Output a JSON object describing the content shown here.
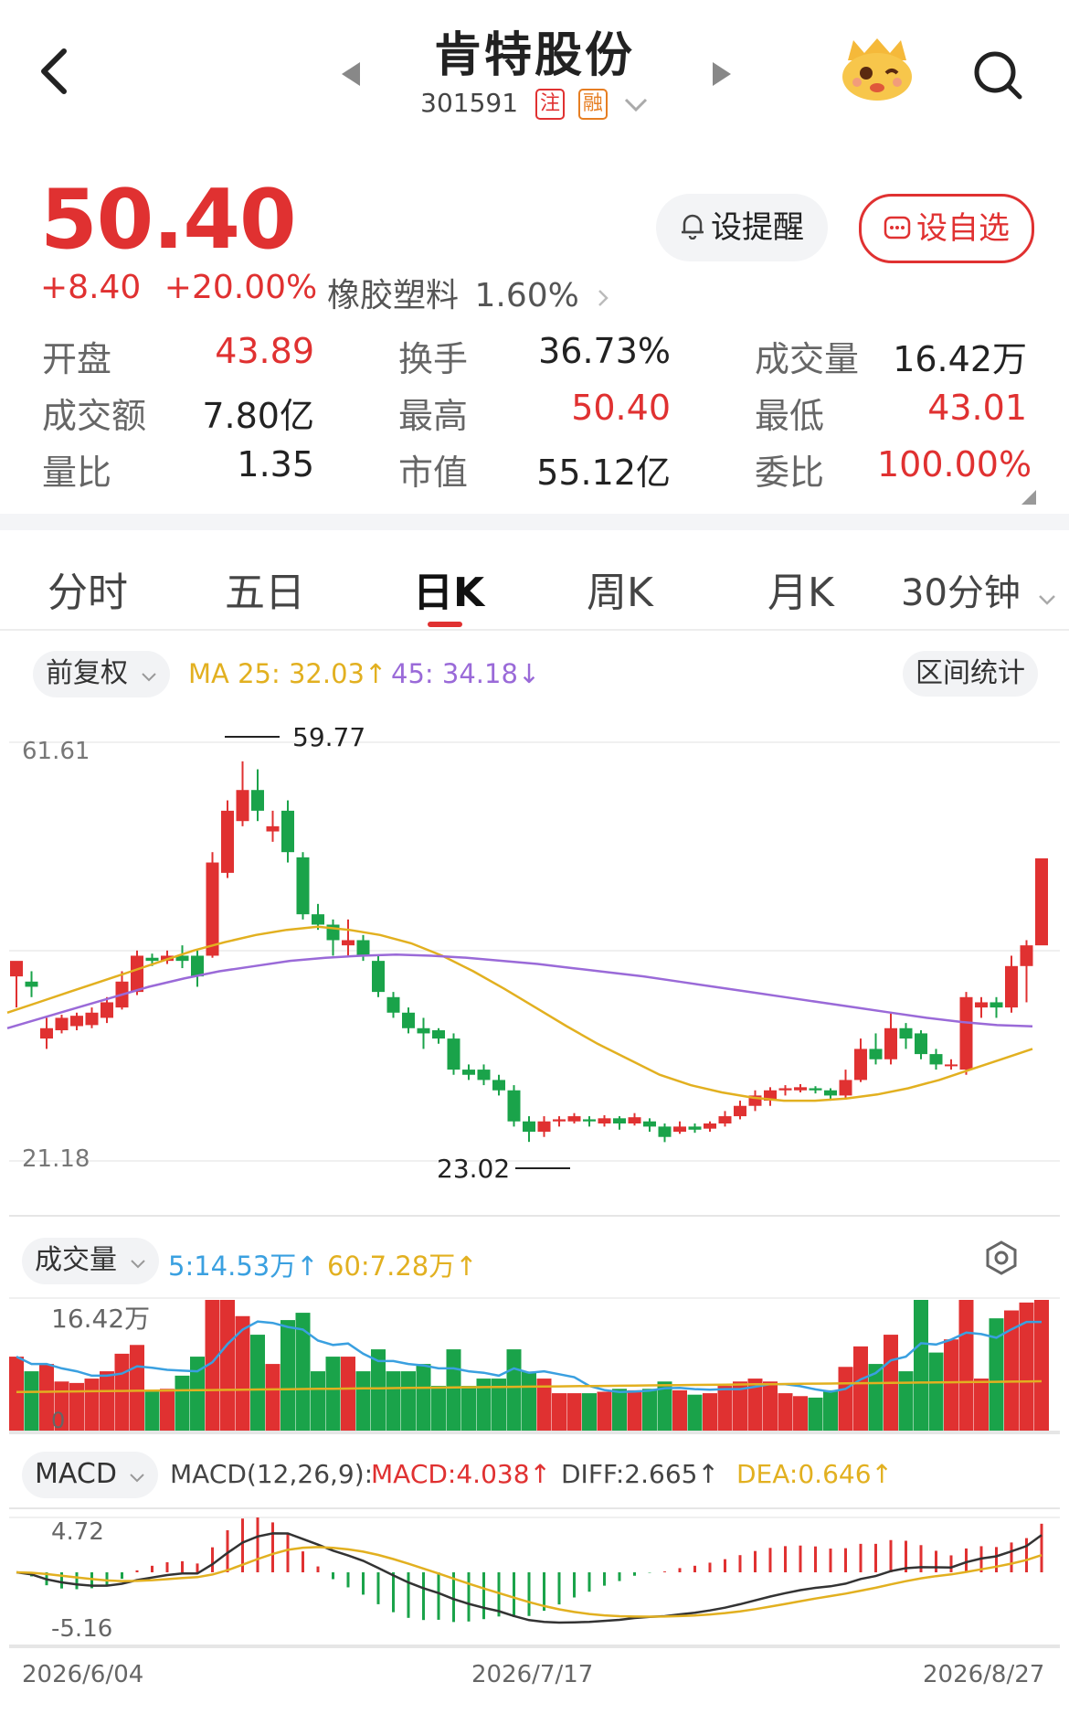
{
  "header": {
    "title": "肯特股份",
    "code": "301591",
    "tag_1": "注",
    "tag_2": "融"
  },
  "quote": {
    "price": "50.40",
    "change": "+8.40",
    "change_pct": "+20.00%",
    "sector": "橡胶塑料",
    "sector_pct": "1.60%",
    "alert_label": "设提醒",
    "fav_label": "设自选"
  },
  "stats": [
    {
      "label": "开盘",
      "value": "43.89",
      "color": "#e03131"
    },
    {
      "label": "换手",
      "value": "36.73%",
      "color": "#222222"
    },
    {
      "label": "成交量",
      "value": "16.42万",
      "color": "#222222"
    },
    {
      "label": "成交额",
      "value": "7.80亿",
      "color": "#222222"
    },
    {
      "label": "最高",
      "value": "50.40",
      "color": "#e03131"
    },
    {
      "label": "最低",
      "value": "43.01",
      "color": "#e03131"
    },
    {
      "label": "量比",
      "value": "1.35",
      "color": "#222222"
    },
    {
      "label": "市值",
      "value": "55.12亿",
      "color": "#222222"
    },
    {
      "label": "委比",
      "value": "100.00%",
      "color": "#e03131"
    }
  ],
  "tabs": {
    "t1": "分时",
    "t2": "五日",
    "t3": "日K",
    "t4": "周K",
    "t5": "月K",
    "t6": "30分钟",
    "active": "日K"
  },
  "kline": {
    "adjust": "前复权",
    "ma25": "MA 25: 32.03↑",
    "ma45": "45: 34.18↓",
    "range_stats": "区间统计",
    "ymax_label": "61.61",
    "ymin_label": "21.18",
    "high_label": "59.77",
    "low_label": "23.02"
  },
  "volume": {
    "label": "成交量",
    "ma5": "5:14.53万↑",
    "ma60": "60:7.28万↑",
    "max_label": "16.42万",
    "zero_label": "0"
  },
  "macd": {
    "label": "MACD",
    "params": "MACD(12,26,9):",
    "macd": "MACD:4.038↑",
    "diff": "DIFF:2.665↑",
    "dea": "DEA:0.646↑",
    "top_label": "4.72",
    "bottom_label": "-5.16"
  },
  "dates": {
    "d1": "2026/6/04",
    "d2": "2026/7/17",
    "d3": "2026/8/27"
  },
  "colors": {
    "up": "#e03131",
    "down": "#1aa34a",
    "ma25": "#e2b020",
    "ma45": "#9a6ad8",
    "ma5_vol": "#3aa0e0"
  },
  "chart_data": {
    "type": "candlestick",
    "ylim": [
      21.18,
      61.61
    ],
    "candles": [
      [
        39.0,
        40.5,
        36.0,
        39.5
      ],
      [
        38.5,
        38.0,
        37.0,
        39.5
      ],
      [
        33.0,
        34.0,
        32.0,
        35.0
      ],
      [
        33.8,
        35.0,
        33.5,
        35.3
      ],
      [
        34.2,
        35.2,
        33.8,
        35.5
      ],
      [
        34.3,
        35.5,
        34.0,
        36.0
      ],
      [
        35.0,
        36.5,
        34.5,
        37.0
      ],
      [
        36.0,
        38.5,
        35.8,
        39.5
      ],
      [
        37.5,
        41.0,
        37.2,
        41.5
      ],
      [
        40.8,
        40.5,
        40.0,
        41.2
      ],
      [
        40.5,
        41.0,
        40.2,
        41.5
      ],
      [
        41.0,
        40.5,
        39.8,
        42.0
      ],
      [
        41.0,
        39.0,
        38.0,
        41.5
      ],
      [
        41.0,
        50.0,
        40.8,
        51.0
      ],
      [
        49.0,
        55.0,
        48.5,
        56.0
      ],
      [
        54.0,
        57.0,
        53.5,
        59.77
      ],
      [
        57.0,
        55.0,
        54.0,
        59.0
      ],
      [
        53.0,
        53.5,
        52.0,
        55.0
      ],
      [
        55.0,
        51.0,
        50.0,
        56.0
      ],
      [
        50.5,
        45.0,
        44.5,
        51.0
      ],
      [
        45.0,
        44.0,
        43.5,
        46.0
      ],
      [
        44.0,
        42.5,
        41.0,
        44.5
      ],
      [
        42.0,
        42.5,
        41.0,
        44.5
      ],
      [
        42.5,
        41.0,
        40.5,
        43.0
      ],
      [
        40.5,
        37.5,
        37.0,
        41.0
      ],
      [
        37.0,
        35.5,
        35.0,
        37.5
      ],
      [
        35.5,
        34.0,
        33.5,
        36.0
      ],
      [
        34.0,
        33.5,
        32.0,
        35.0
      ],
      [
        33.8,
        33.0,
        32.5,
        34.0
      ],
      [
        33.0,
        30.0,
        29.5,
        33.5
      ],
      [
        30.0,
        29.5,
        29.0,
        30.5
      ],
      [
        30.0,
        29.0,
        28.5,
        30.5
      ],
      [
        29.0,
        28.0,
        27.5,
        29.5
      ],
      [
        28.0,
        25.0,
        24.5,
        28.5
      ],
      [
        25.0,
        24.0,
        23.02,
        25.5
      ],
      [
        24.0,
        25.0,
        23.5,
        25.5
      ],
      [
        25.0,
        25.2,
        24.5,
        25.5
      ],
      [
        25.0,
        25.5,
        24.8,
        25.8
      ],
      [
        25.2,
        25.0,
        24.5,
        25.5
      ],
      [
        24.8,
        25.3,
        24.5,
        25.6
      ],
      [
        25.3,
        24.8,
        24.2,
        25.5
      ],
      [
        24.8,
        25.4,
        24.6,
        25.8
      ],
      [
        25.0,
        24.5,
        24.0,
        25.3
      ],
      [
        24.5,
        23.5,
        23.0,
        24.8
      ],
      [
        24.0,
        24.5,
        23.8,
        25.0
      ],
      [
        24.5,
        24.2,
        23.9,
        24.8
      ],
      [
        24.3,
        24.8,
        24.0,
        25.0
      ],
      [
        24.8,
        25.5,
        24.5,
        26.0
      ],
      [
        25.5,
        26.5,
        25.2,
        27.0
      ],
      [
        26.5,
        27.5,
        26.0,
        28.0
      ],
      [
        27.0,
        28.0,
        26.5,
        28.3
      ],
      [
        28.0,
        28.2,
        27.5,
        28.5
      ],
      [
        28.0,
        28.3,
        27.8,
        28.6
      ],
      [
        28.2,
        28.0,
        27.7,
        28.4
      ],
      [
        28.0,
        27.5,
        27.0,
        28.2
      ],
      [
        27.5,
        29.0,
        27.2,
        30.0
      ],
      [
        29.0,
        32.0,
        28.8,
        33.0
      ],
      [
        32.0,
        31.0,
        30.5,
        33.5
      ],
      [
        31.0,
        34.0,
        30.5,
        35.5
      ],
      [
        34.0,
        33.0,
        32.0,
        34.5
      ],
      [
        33.5,
        31.5,
        31.0,
        33.8
      ],
      [
        31.5,
        30.5,
        30.0,
        32.0
      ],
      [
        30.5,
        30.5,
        30.0,
        31.0
      ],
      [
        30.0,
        37.0,
        29.5,
        37.5
      ],
      [
        36.0,
        36.5,
        35.0,
        37.0
      ],
      [
        36.5,
        36.0,
        35.0,
        37.0
      ],
      [
        36.0,
        40.0,
        35.5,
        41.0
      ],
      [
        40.0,
        42.0,
        36.5,
        42.5
      ],
      [
        42.0,
        50.4,
        43.01,
        50.4
      ]
    ],
    "ma25": [
      35.5,
      36.5,
      37.5,
      38.5,
      39.5,
      40.5,
      41.5,
      42.3,
      43.0,
      43.5,
      43.8,
      43.5,
      43.0,
      42.2,
      41.0,
      39.5,
      37.8,
      36.0,
      34.2,
      32.5,
      31.0,
      29.5,
      28.5,
      27.8,
      27.3,
      27.0,
      27.0,
      27.2,
      27.6,
      28.2,
      29.0,
      30.0,
      31.0,
      32.0
    ],
    "ma45": [
      34.0,
      35.0,
      36.0,
      37.0,
      38.0,
      38.8,
      39.5,
      40.0,
      40.5,
      40.8,
      41.0,
      41.1,
      41.0,
      40.8,
      40.5,
      40.2,
      39.8,
      39.4,
      39.0,
      38.5,
      38.0,
      37.5,
      37.0,
      36.5,
      36.0,
      35.5,
      35.0,
      34.6,
      34.3,
      34.18
    ],
    "volume_max_label": "16.42万",
    "macd_range": [
      -5.16,
      4.72
    ]
  }
}
